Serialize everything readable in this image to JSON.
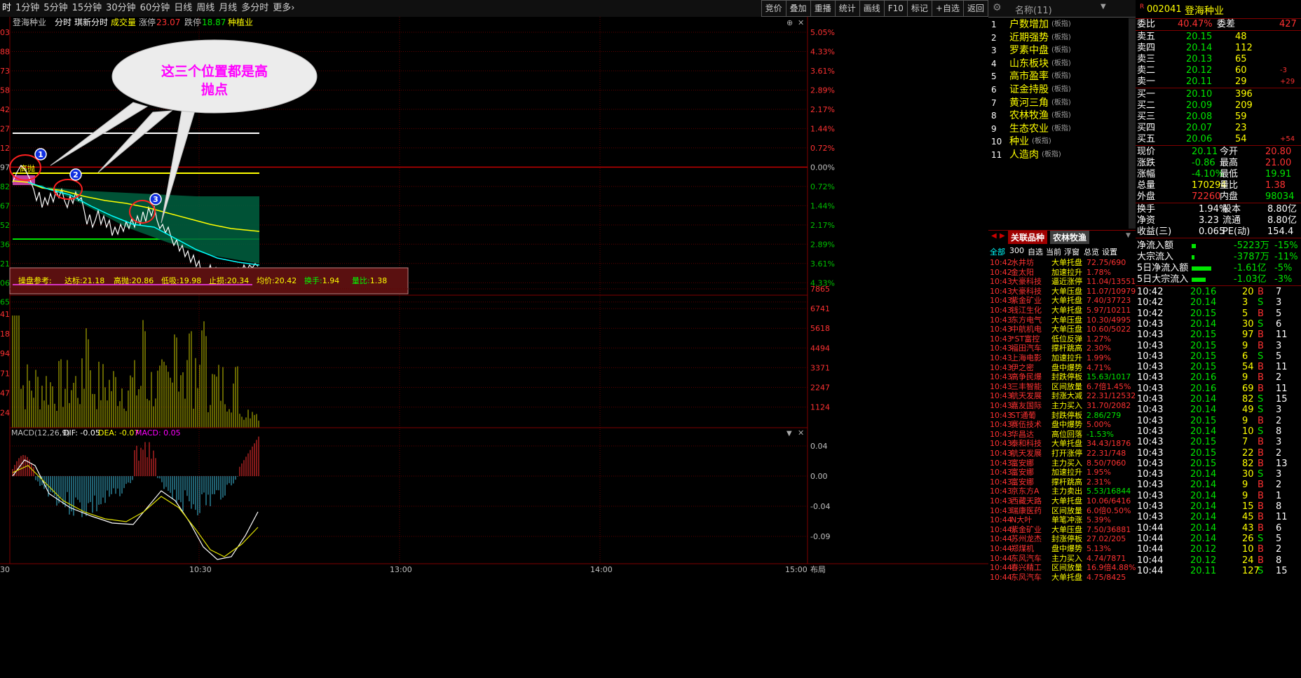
{
  "toolbar": {
    "periods": [
      "时",
      "1分钟",
      "5分钟",
      "15分钟",
      "30分钟",
      "60分钟",
      "日线",
      "周线",
      "月线",
      "多分时",
      "更多›"
    ],
    "tools": [
      "竞价",
      "叠加",
      "重播",
      "统计",
      "画线",
      "F10",
      "标记",
      "+自选",
      "返回"
    ]
  },
  "info": {
    "name": "登海种业",
    "mode": "分时",
    "mode2": "琪新分时",
    "volume_label": "成交量",
    "up_limit_label": "涨停",
    "up_limit": "23.07",
    "down_limit_label": "跌停",
    "down_limit": "18.87",
    "sector": "种植业"
  },
  "price_axis": {
    "left": [
      "03",
      "88",
      "73",
      "58",
      "42",
      "27",
      "12",
      "97",
      "82",
      "67",
      "52",
      "36",
      "21",
      "06",
      "65"
    ],
    "right": [
      "5.05%",
      "4.33%",
      "3.61%",
      "2.89%",
      "2.17%",
      "1.44%",
      "0.72%",
      "0.00%",
      "0.72%",
      "1.44%",
      "2.17%",
      "2.89%",
      "3.61%",
      "4.33%",
      ""
    ]
  },
  "vol_axis": {
    "left": [
      "41",
      "18",
      "94",
      "71",
      "47",
      "24"
    ],
    "right": [
      "7865",
      "6741",
      "5618",
      "4494",
      "3371",
      "2247",
      "1124"
    ]
  },
  "macd": {
    "label": "MACD(12,26,9)",
    "dif": "DIF: -0.05",
    "dea": "DEA: -0.07",
    "macd": "MACD: 0.05",
    "right": [
      "0.04",
      "0.00",
      "-0.04",
      "-0.09"
    ]
  },
  "time_axis": [
    "30",
    "10:30",
    "13:00",
    "14:00",
    "15:00"
  ],
  "bottom_right": "布局",
  "callout": {
    "line1": "这三个位置都是高",
    "line2": "抛点",
    "markers": [
      "1",
      "2",
      "3"
    ]
  },
  "ref": {
    "title": "操盘参考:",
    "items": [
      {
        "k": "达标:",
        "v": "21.18"
      },
      {
        "k": "高抛:",
        "v": "20.86"
      },
      {
        "k": "低吸:",
        "v": "19.98"
      },
      {
        "k": "止损:",
        "v": "20.34"
      },
      {
        "k": "均价:",
        "v": "20.42"
      },
      {
        "k": "换手:",
        "v": "1.94"
      },
      {
        "k": "量比:",
        "v": "1.38"
      }
    ]
  },
  "marker_text": "高抛",
  "sectors": {
    "header": "名称(11)",
    "items": [
      {
        "n": "1",
        "name": "户数增加",
        "tag": "(板指)"
      },
      {
        "n": "2",
        "name": "近期强势",
        "tag": "(板指)"
      },
      {
        "n": "3",
        "name": "罗素中盘",
        "tag": "(板指)"
      },
      {
        "n": "4",
        "name": "山东板块",
        "tag": "(板指)"
      },
      {
        "n": "5",
        "name": "高市盈率",
        "tag": "(板指)"
      },
      {
        "n": "6",
        "name": "证金持股",
        "tag": "(板指)"
      },
      {
        "n": "7",
        "name": "黄河三角",
        "tag": "(板指)"
      },
      {
        "n": "8",
        "name": "农林牧渔",
        "tag": "(板指)"
      },
      {
        "n": "9",
        "name": "生态农业",
        "tag": "(板指)"
      },
      {
        "n": "10",
        "name": "种业",
        "tag": "(板指)"
      },
      {
        "n": "11",
        "name": "人造肉",
        "tag": "(板指)"
      }
    ]
  },
  "tabs": {
    "t1": "关联品种",
    "t2": "农林牧渔"
  },
  "filters": [
    "全部",
    "300",
    "自选",
    "当前",
    "浮窗",
    "总览",
    "设置"
  ],
  "news": [
    [
      "10:42",
      "水井坊",
      "大单托盘",
      "72.75/690"
    ],
    [
      "10:42",
      "金太阳",
      "加速拉升",
      "1.78%"
    ],
    [
      "10:43",
      "大豪科技",
      "逼近涨停",
      "11.04/13551"
    ],
    [
      "10:43",
      "大豪科技",
      "大单压盘",
      "11.07/10979"
    ],
    [
      "10:43",
      "紫金矿业",
      "大单托盘",
      "7.40/37723"
    ],
    [
      "10:43",
      "钱江生化",
      "大单托盘",
      "5.97/10211"
    ],
    [
      "10:43",
      "东方电气",
      "大单压盘",
      "10.30/4995"
    ],
    [
      "10:43",
      "中航机电",
      "大单压盘",
      "10.60/5022"
    ],
    [
      "10:43",
      "*ST富控",
      "低位反弹",
      "1.27%"
    ],
    [
      "10:43",
      "福田汽车",
      "撑杆跳高",
      "2.30%"
    ],
    [
      "10:43",
      "上海电影",
      "加速拉升",
      "1.99%"
    ],
    [
      "10:43",
      "伊之密",
      "盘中爆势",
      "4.71%"
    ],
    [
      "10:43",
      "高争民爆",
      "封跌停板",
      "15.63/1017"
    ],
    [
      "10:43",
      "三丰智能",
      "区间放量",
      "6.7倍1.45%"
    ],
    [
      "10:43",
      "航天发展",
      "封涨大减",
      "22.31/12532"
    ],
    [
      "10:43",
      "嘉友国际",
      "主力买入",
      "31.70/2082"
    ],
    [
      "10:43",
      "ST通葡",
      "封跌停板",
      "2.86/279"
    ],
    [
      "10:43",
      "赛伍技术",
      "盘中爆势",
      "5.00%"
    ],
    [
      "10:43",
      "华昌达",
      "高位回落",
      "-1.53%"
    ],
    [
      "10:43",
      "泰和科技",
      "大单托盘",
      "34.43/1876"
    ],
    [
      "10:43",
      "航天发展",
      "打开涨停",
      "22.31/748"
    ],
    [
      "10:43",
      "富安娜",
      "主力买入",
      "8.50/7060"
    ],
    [
      "10:43",
      "富安娜",
      "加速拉升",
      "1.95%"
    ],
    [
      "10:43",
      "富安娜",
      "撑杆跳高",
      "2.31%"
    ],
    [
      "10:43",
      "京东方A",
      "主力卖出",
      "5.53/16844"
    ],
    [
      "10:43",
      "西藏天路",
      "大单托盘",
      "10.06/6416"
    ],
    [
      "10:43",
      "瑞康医药",
      "区间放量",
      "6.0倍0.50%"
    ],
    [
      "10:44",
      "N大叶",
      "单笔冲涨",
      "5.39%"
    ],
    [
      "10:44",
      "紫金矿业",
      "大单压盘",
      "7.50/36881"
    ],
    [
      "10:44",
      "苏州龙杰",
      "封涨停板",
      "27.02/205"
    ],
    [
      "10:44",
      "郑煤机",
      "盘中爆势",
      "5.13%"
    ],
    [
      "10:44",
      "东风汽车",
      "主力买入",
      "4.74/7871"
    ],
    [
      "10:44",
      "春兴精工",
      "区间放量",
      "16.9倍4.88%"
    ],
    [
      "10:44",
      "东风汽车",
      "大单托盘",
      "4.75/8425"
    ]
  ],
  "quote": {
    "code": "002041",
    "name": "登海种业",
    "badge": "R",
    "wb": {
      "k": "委比",
      "v": "40.47%",
      "k2": "委差",
      "v2": "427"
    },
    "sell": [
      [
        "卖五",
        "20.15",
        "48",
        ""
      ],
      [
        "卖四",
        "20.14",
        "112",
        ""
      ],
      [
        "卖三",
        "20.13",
        "65",
        ""
      ],
      [
        "卖二",
        "20.12",
        "60",
        "-3"
      ],
      [
        "卖一",
        "20.11",
        "29",
        "+29"
      ]
    ],
    "buy": [
      [
        "买一",
        "20.10",
        "396",
        ""
      ],
      [
        "买二",
        "20.09",
        "209",
        ""
      ],
      [
        "买三",
        "20.08",
        "59",
        ""
      ],
      [
        "买四",
        "20.07",
        "23",
        ""
      ],
      [
        "买五",
        "20.06",
        "54",
        "+54"
      ]
    ],
    "stats": [
      [
        "现价",
        "20.11",
        "今开",
        "20.80"
      ],
      [
        "涨跌",
        "-0.86",
        "最高",
        "21.00"
      ],
      [
        "涨幅",
        "-4.10%",
        "最低",
        "19.91"
      ],
      [
        "总量",
        "170294",
        "量比",
        "1.38"
      ],
      [
        "外盘",
        "72260",
        "内盘",
        "98034"
      ]
    ],
    "stats2": [
      [
        "换手",
        "1.94%",
        "股本",
        "8.80亿"
      ],
      [
        "净资",
        "3.23",
        "流通",
        "8.80亿"
      ],
      [
        "收益(三)",
        "0.065",
        "PE(动)",
        "154.4"
      ]
    ],
    "flow": [
      [
        "净流入额",
        "-5223万",
        "-15%"
      ],
      [
        "大宗流入",
        "-3787万",
        "-11%"
      ],
      [
        "5日净流入额",
        "-1.61亿",
        "-5%"
      ],
      [
        "5日大宗流入",
        "-1.03亿",
        "-3%"
      ]
    ],
    "ticks": [
      [
        "10:42",
        "20.16",
        "20",
        "B",
        "7"
      ],
      [
        "10:42",
        "20.14",
        "3",
        "S",
        "3"
      ],
      [
        "10:42",
        "20.15",
        "5",
        "B",
        "5"
      ],
      [
        "10:43",
        "20.14",
        "30",
        "S",
        "6"
      ],
      [
        "10:43",
        "20.15",
        "97",
        "B",
        "11"
      ],
      [
        "10:43",
        "20.15",
        "9",
        "B",
        "3"
      ],
      [
        "10:43",
        "20.15",
        "6",
        "S",
        "5"
      ],
      [
        "10:43",
        "20.15",
        "54",
        "B",
        "11"
      ],
      [
        "10:43",
        "20.16",
        "9",
        "B",
        "2"
      ],
      [
        "10:43",
        "20.16",
        "69",
        "B",
        "11"
      ],
      [
        "10:43",
        "20.14",
        "82",
        "S",
        "15"
      ],
      [
        "10:43",
        "20.14",
        "49",
        "S",
        "3"
      ],
      [
        "10:43",
        "20.15",
        "9",
        "B",
        "2"
      ],
      [
        "10:43",
        "20.14",
        "10",
        "S",
        "8"
      ],
      [
        "10:43",
        "20.15",
        "7",
        "B",
        "3"
      ],
      [
        "10:43",
        "20.15",
        "22",
        "B",
        "2"
      ],
      [
        "10:43",
        "20.15",
        "82",
        "B",
        "13"
      ],
      [
        "10:43",
        "20.14",
        "30",
        "S",
        "3"
      ],
      [
        "10:43",
        "20.14",
        "9",
        "B",
        "2"
      ],
      [
        "10:43",
        "20.14",
        "9",
        "B",
        "1"
      ],
      [
        "10:43",
        "20.14",
        "15",
        "B",
        "8"
      ],
      [
        "10:43",
        "20.14",
        "45",
        "B",
        "11"
      ],
      [
        "10:44",
        "20.14",
        "43",
        "B",
        "6"
      ],
      [
        "10:44",
        "20.14",
        "26",
        "S",
        "5"
      ],
      [
        "10:44",
        "20.12",
        "10",
        "B",
        "2"
      ],
      [
        "10:44",
        "20.12",
        "24",
        "B",
        "8"
      ],
      [
        "10:44",
        "20.11",
        "127",
        "S",
        "15"
      ]
    ]
  }
}
